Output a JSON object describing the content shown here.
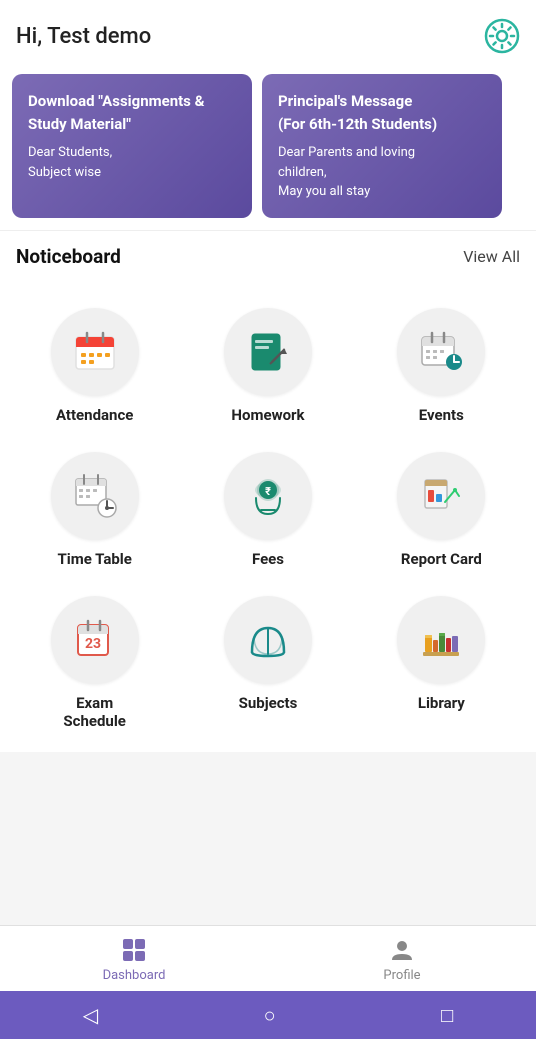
{
  "header": {
    "greeting": "Hi, Test demo",
    "settings_icon": "gear-icon"
  },
  "banners": [
    {
      "title": "Download \"Assignments & Study Material\"",
      "body": "Dear Students,\nSubject wise"
    },
    {
      "title": "Principal's Message (For 6th-12th Students)",
      "body": "Dear Parents and loving children,\nMay you all stay"
    }
  ],
  "noticeboard": {
    "title": "Noticeboard",
    "view_all": "View All"
  },
  "menu_items": [
    {
      "id": "attendance",
      "label": "Attendance"
    },
    {
      "id": "homework",
      "label": "Homework"
    },
    {
      "id": "events",
      "label": "Events"
    },
    {
      "id": "timetable",
      "label": "Time Table"
    },
    {
      "id": "fees",
      "label": "Fees"
    },
    {
      "id": "reportcard",
      "label": "Report Card"
    },
    {
      "id": "examschedule",
      "label": "Exam Schedule"
    },
    {
      "id": "subjects",
      "label": "Subjects"
    },
    {
      "id": "library",
      "label": "Library"
    }
  ],
  "bottom_nav": [
    {
      "id": "dashboard",
      "label": "Dashboard",
      "active": true
    },
    {
      "id": "profile",
      "label": "Profile",
      "active": false
    }
  ],
  "android_nav": {
    "back": "◁",
    "home": "○",
    "recent": "□"
  }
}
